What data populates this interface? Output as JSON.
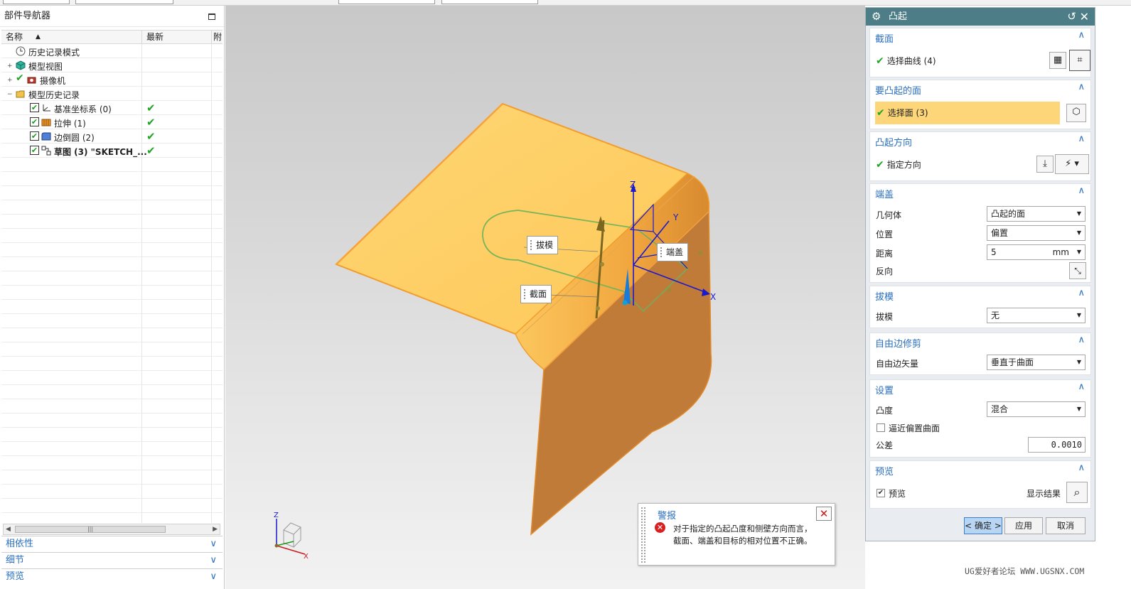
{
  "navigator": {
    "title": "部件导航器",
    "columns": [
      "名称",
      "最新",
      "附"
    ],
    "tree": [
      {
        "label": "历史记录模式",
        "icon": "clock-icon",
        "latest": ""
      },
      {
        "label": "模型视图",
        "icon": "model-views-icon",
        "latest": ""
      },
      {
        "label": "摄像机",
        "icon": "camera-icon",
        "latest": ""
      },
      {
        "label": "模型历史记录",
        "icon": "folder-icon",
        "latest": ""
      },
      {
        "label": "基准坐标系 (0)",
        "icon": "datum-csys-icon",
        "latest": "✔"
      },
      {
        "label": "拉伸 (1)",
        "icon": "extrude-icon",
        "latest": "✔"
      },
      {
        "label": "边倒圆 (2)",
        "icon": "edge-blend-icon",
        "latest": "✔"
      },
      {
        "label": "草图 (3) \"SKETCH_...",
        "icon": "sketch-icon",
        "latest": "✔"
      }
    ],
    "sections": [
      "相依性",
      "细节",
      "预览"
    ]
  },
  "viewport": {
    "labels": {
      "draft": "拔模",
      "cap": "端盖",
      "section": "截面"
    },
    "axes": {
      "z": "Z",
      "y": "Y",
      "x": "X"
    }
  },
  "alert": {
    "title": "警报",
    "message": "对于指定的凸起凸度和侧壁方向而言，截面、端盖和目标的相对位置不正确。"
  },
  "dialog": {
    "title": "凸起",
    "sections": {
      "section": {
        "title": "截面",
        "select_curve": "选择曲线 (4)"
      },
      "face_to_emboss": {
        "title": "要凸起的面",
        "select_face": "选择面 (3)"
      },
      "direction": {
        "title": "凸起方向",
        "specify_direction": "指定方向"
      },
      "cap": {
        "title": "端盖",
        "geometry_label": "几何体",
        "geometry_value": "凸起的面",
        "location_label": "位置",
        "location_value": "偏置",
        "distance_label": "距离",
        "distance_value": "5",
        "distance_unit": "mm",
        "reverse_label": "反向"
      },
      "draft": {
        "title": "拔模",
        "draft_label": "拔模",
        "draft_value": "无"
      },
      "free_edge": {
        "title": "自由边修剪",
        "vector_label": "自由边矢量",
        "vector_value": "垂直于曲面"
      },
      "settings": {
        "title": "设置",
        "convexity_label": "凸度",
        "convexity_value": "混合",
        "approx_label": "逼近偏置曲面",
        "tolerance_label": "公差",
        "tolerance_value": "0.0010"
      },
      "preview": {
        "title": "预览",
        "preview_label": "预览",
        "show_result": "显示结果"
      }
    },
    "buttons": {
      "ok": "< 确定 >",
      "apply": "应用",
      "cancel": "取消"
    }
  },
  "watermark": "UG爱好者论坛 WWW.UGSNX.COM",
  "colors": {
    "accent": "#2a6fc0",
    "title_bar": "#4d7d86",
    "face_selected": "#fdd679",
    "ok_check": "#22a522",
    "error": "#d92020"
  }
}
